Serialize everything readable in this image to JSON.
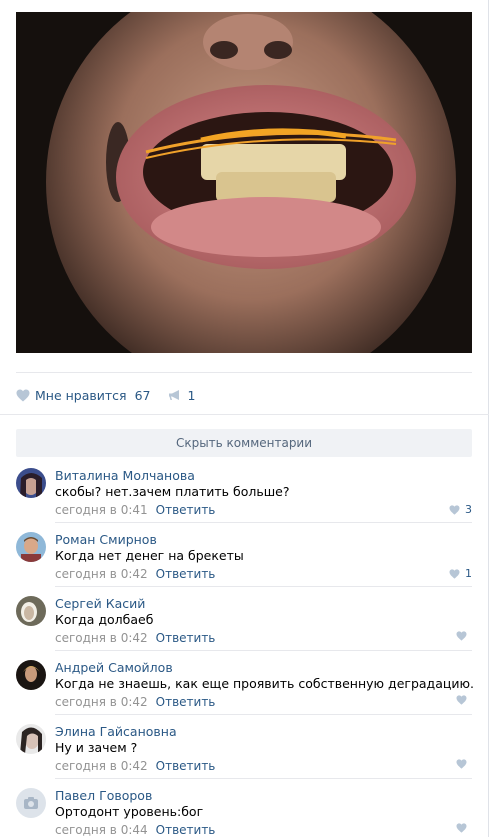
{
  "post": {
    "likes_label": "Мне нравится",
    "likes_count": "67",
    "shares_count": "1",
    "hide_comments_label": "Скрыть комментарии"
  },
  "comments": [
    {
      "author": "Виталина Молчанова",
      "text": "скобы? нет.зачем платить больше?",
      "time": "сегодня в 0:41",
      "reply": "Ответить",
      "likes": "3"
    },
    {
      "author": "Роман Смирнов",
      "text": "Когда нет денег на брекеты",
      "time": "сегодня в 0:42",
      "reply": "Ответить",
      "likes": "1"
    },
    {
      "author": "Сергей Касий",
      "text": "Когда долбаеб",
      "time": "сегодня в 0:42",
      "reply": "Ответить",
      "likes": ""
    },
    {
      "author": "Андрей Самойлов",
      "text": "Когда не знаешь, как еще проявить собственную деградацию.",
      "time": "сегодня в 0:42",
      "reply": "Ответить",
      "likes": ""
    },
    {
      "author": "Элина Гайсановна",
      "text": "Ну и зачем ?",
      "time": "сегодня в 0:42",
      "reply": "Ответить",
      "likes": ""
    },
    {
      "author": "Павел Говоров",
      "text": "Ортодонт уровень:бог",
      "time": "сегодня в 0:44",
      "reply": "Ответить",
      "likes": ""
    }
  ],
  "colors": {
    "link": "#2a5885",
    "meta": "#939393",
    "accent_bg": "#f0f2f5"
  },
  "icons": {
    "like": "heart-icon",
    "share": "megaphone-icon",
    "no_avatar": "camera-icon"
  }
}
